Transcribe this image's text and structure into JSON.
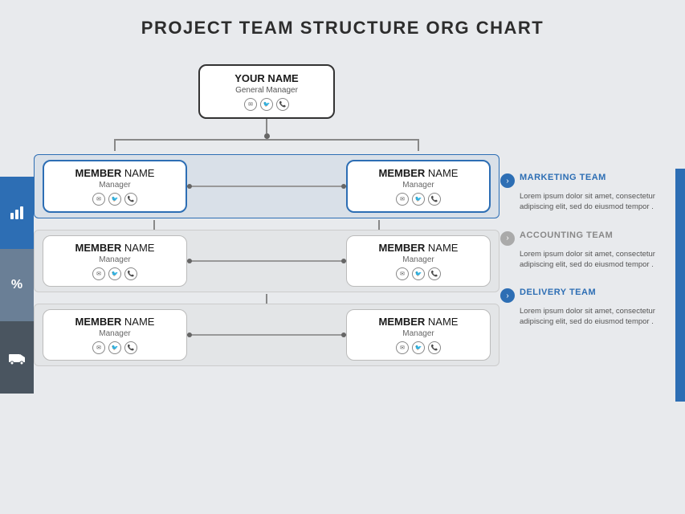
{
  "page": {
    "title": "PROJECT TEAM STRUCTURE ORG CHART"
  },
  "top_node": {
    "name": "YOUR NAME",
    "role": "General Manager"
  },
  "icons": {
    "email": "✉",
    "twitter": "🐦",
    "phone": "📞",
    "chart_bar": "📊",
    "percent": "%",
    "delivery": "🚚"
  },
  "rows": [
    {
      "id": "row1",
      "style": "active",
      "left": {
        "name_bold": "MEMBER",
        "name_plain": " NAME",
        "role": "Manager"
      },
      "right": {
        "name_bold": "MEMBER",
        "name_plain": " NAME",
        "role": "Manager"
      }
    },
    {
      "id": "row2",
      "style": "inactive",
      "left": {
        "name_bold": "MEMBER",
        "name_plain": " NAME",
        "role": "Manager"
      },
      "right": {
        "name_bold": "MEMBER",
        "name_plain": " NAME",
        "role": "Manager"
      }
    },
    {
      "id": "row3",
      "style": "inactive",
      "left": {
        "name_bold": "MEMBER",
        "name_plain": " NAME",
        "role": "Manager"
      },
      "right": {
        "name_bold": "MEMBER",
        "name_plain": " NAME",
        "role": "Manager"
      }
    }
  ],
  "right_panel": {
    "teams": [
      {
        "id": "marketing",
        "name": "MARKETING TEAM",
        "color": "blue",
        "description": "Lorem ipsum dolor sit amet, consectetur adipiscing elit, sed do eiusmod tempor ."
      },
      {
        "id": "accounting",
        "name": "ACCOUNTING TEAM",
        "color": "gray",
        "description": "Lorem ipsum dolor sit amet, consectetur adipiscing elit, sed do eiusmod tempor ."
      },
      {
        "id": "delivery",
        "name": "DELIVERY TEAM",
        "color": "gray",
        "description": "Lorem ipsum dolor sit amet, consectetur adipiscing elit, sed do eiusmod tempor ."
      }
    ]
  },
  "sidebar": {
    "icons": [
      "📊",
      "%",
      "🚚"
    ]
  }
}
